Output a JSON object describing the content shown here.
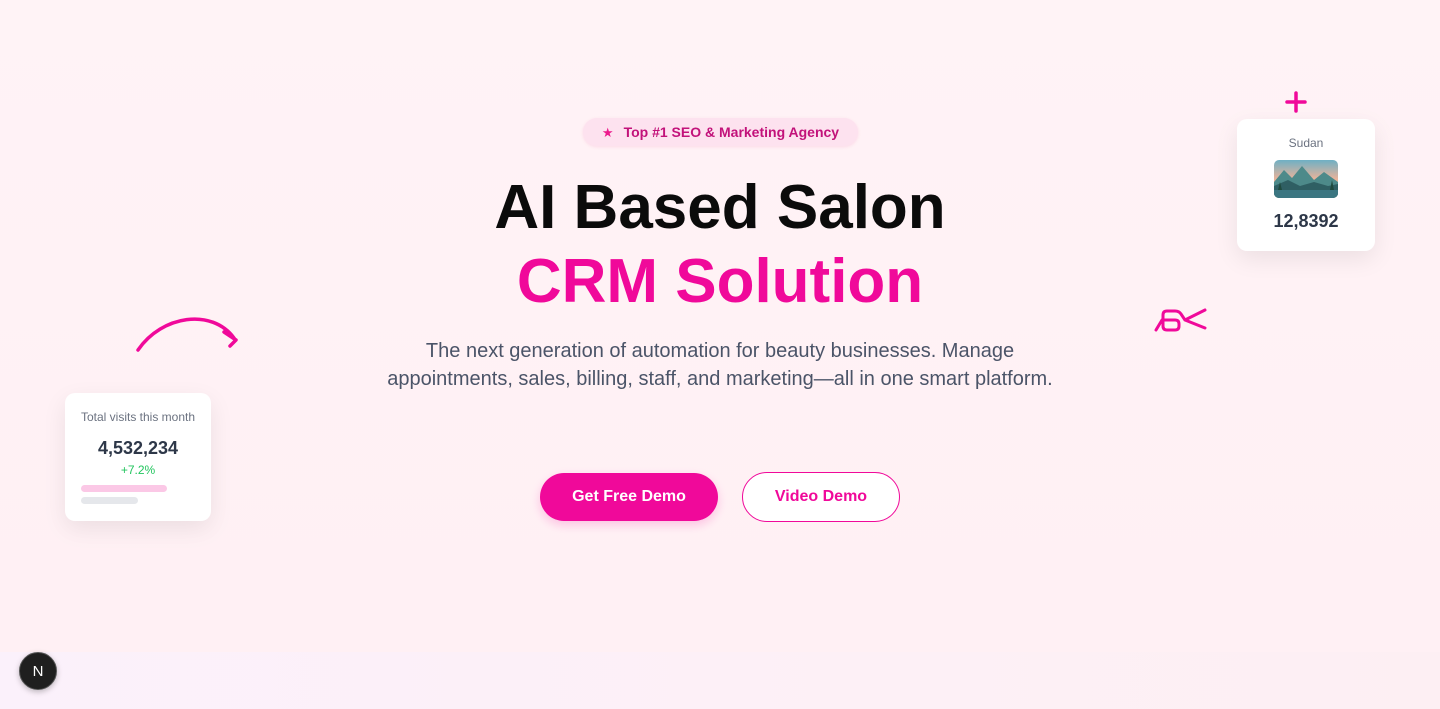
{
  "badge": {
    "icon": "star-icon",
    "text": "Top #1 SEO & Marketing Agency"
  },
  "hero": {
    "title_line1": "AI Based Salon",
    "title_line2": "CRM Solution",
    "subtitle": "The next generation of automation for beauty businesses. Manage appointments, sales, billing, staff, and marketing—all in one smart platform."
  },
  "buttons": {
    "primary": "Get Free Demo",
    "secondary": "Video Demo"
  },
  "visits_card": {
    "label": "Total visits this month",
    "value": "4,532,234",
    "change": "+7.2%"
  },
  "country_card": {
    "name": "Sudan",
    "value": "12,8392"
  },
  "dev_badge": {
    "letter": "N"
  },
  "colors": {
    "accent": "#f0099a",
    "text_dark": "#0b0b0b",
    "subtitle": "#4b5468",
    "positive": "#22c55e"
  }
}
